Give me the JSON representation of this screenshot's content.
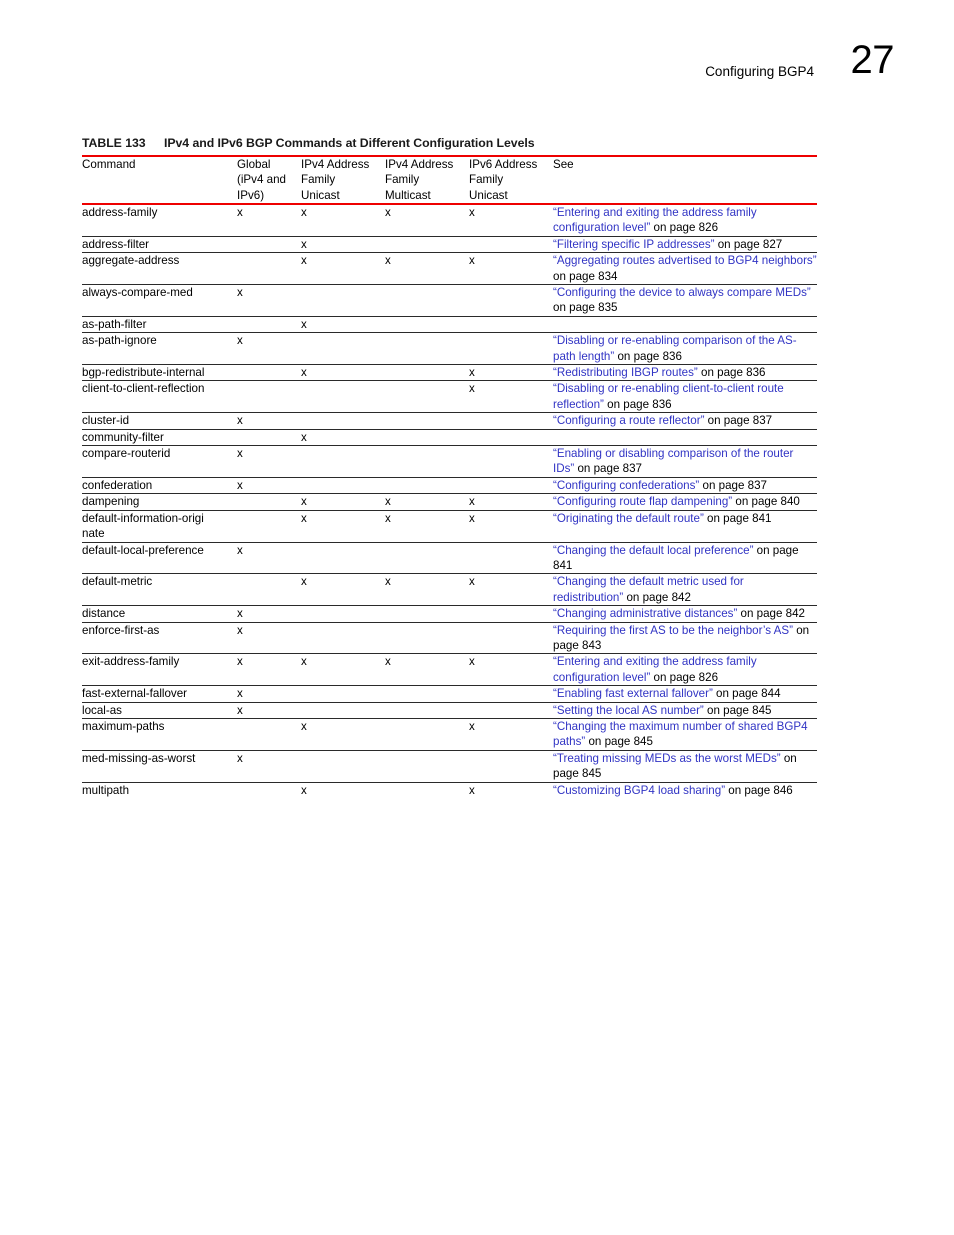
{
  "header": {
    "chapter_title": "Configuring BGP4",
    "page_number": "27"
  },
  "table": {
    "caption_label": "TABLE 133",
    "caption_title": "IPv4 and IPv6 BGP Commands at Different Configuration Levels",
    "columns": [
      {
        "id": "command",
        "lines": [
          "Command"
        ]
      },
      {
        "id": "global",
        "lines": [
          "Global",
          "(iPv4 and",
          "IPv6)"
        ]
      },
      {
        "id": "ipv4_unicast",
        "lines": [
          "IPv4 Address",
          "Family",
          "Unicast"
        ]
      },
      {
        "id": "ipv4_multicast",
        "lines": [
          "IPv4 Address",
          "Family",
          "Multicast"
        ]
      },
      {
        "id": "ipv6_unicast",
        "lines": [
          "IPv6 Address",
          "Family",
          "Unicast"
        ]
      },
      {
        "id": "see",
        "lines": [
          "See"
        ]
      }
    ],
    "mark": "x",
    "rows": [
      {
        "command": "address-family",
        "global": "x",
        "ipv4_unicast": "x",
        "ipv4_multicast": "x",
        "ipv6_unicast": "x",
        "see_title": "“Entering and exiting the address family configuration level”",
        "see_tail": " on page 826"
      },
      {
        "command": "address-filter",
        "global": "",
        "ipv4_unicast": "x",
        "ipv4_multicast": "",
        "ipv6_unicast": "",
        "see_title": "“Filtering specific IP addresses”",
        "see_tail": " on page 827"
      },
      {
        "command": "aggregate-address",
        "global": "",
        "ipv4_unicast": "x",
        "ipv4_multicast": "x",
        "ipv6_unicast": "x",
        "see_title": "“Aggregating routes advertised to BGP4 neighbors”",
        "see_tail": " on page 834"
      },
      {
        "command": "always-compare-med",
        "global": "x",
        "ipv4_unicast": "",
        "ipv4_multicast": "",
        "ipv6_unicast": "",
        "see_title": "“Configuring the device to always compare MEDs”",
        "see_tail": " on page 835"
      },
      {
        "command": "as-path-filter",
        "global": "",
        "ipv4_unicast": "x",
        "ipv4_multicast": "",
        "ipv6_unicast": "",
        "see_title": "",
        "see_tail": ""
      },
      {
        "command": "as-path-ignore",
        "global": "x",
        "ipv4_unicast": "",
        "ipv4_multicast": "",
        "ipv6_unicast": "",
        "see_title": "“Disabling or re-enabling comparison of the AS-path length”",
        "see_tail": " on page 836"
      },
      {
        "command": "bgp-redistribute-internal",
        "global": "",
        "ipv4_unicast": "x",
        "ipv4_multicast": "",
        "ipv6_unicast": "x",
        "see_title": "“Redistributing IBGP routes”",
        "see_tail": " on page 836"
      },
      {
        "command": "client-to-client-reflection",
        "global": "",
        "ipv4_unicast": "",
        "ipv4_multicast": "",
        "ipv6_unicast": "x",
        "see_title": "“Disabling or re-enabling client-to-client route reflection”",
        "see_tail": " on page 836"
      },
      {
        "command": "cluster-id",
        "global": "x",
        "ipv4_unicast": "",
        "ipv4_multicast": "",
        "ipv6_unicast": "",
        "see_title": "“Configuring a route reflector”",
        "see_tail": " on page 837"
      },
      {
        "command": "community-filter",
        "global": "",
        "ipv4_unicast": "x",
        "ipv4_multicast": "",
        "ipv6_unicast": "",
        "see_title": "",
        "see_tail": ""
      },
      {
        "command": "compare-routerid",
        "global": "x",
        "ipv4_unicast": "",
        "ipv4_multicast": "",
        "ipv6_unicast": "",
        "see_title": "“Enabling or disabling comparison of the router IDs”",
        "see_tail": " on page 837"
      },
      {
        "command": "confederation",
        "global": "x",
        "ipv4_unicast": "",
        "ipv4_multicast": "",
        "ipv6_unicast": "",
        "see_title": "“Configuring confederations”",
        "see_tail": " on page 837"
      },
      {
        "command": "dampening",
        "global": "",
        "ipv4_unicast": "x",
        "ipv4_multicast": "x",
        "ipv6_unicast": "x",
        "see_title": "“Configuring route flap dampening”",
        "see_tail": " on page 840"
      },
      {
        "command": "default-information-origi\nnate",
        "global": "",
        "ipv4_unicast": "x",
        "ipv4_multicast": "x",
        "ipv6_unicast": "x",
        "see_title": "“Originating the default route”",
        "see_tail": " on page 841"
      },
      {
        "command": "default-local-preference",
        "global": "x",
        "ipv4_unicast": "",
        "ipv4_multicast": "",
        "ipv6_unicast": "",
        "see_title": "“Changing the default local preference”",
        "see_tail": " on page 841"
      },
      {
        "command": "default-metric",
        "global": "",
        "ipv4_unicast": "x",
        "ipv4_multicast": "x",
        "ipv6_unicast": "x",
        "see_title": "“Changing the default metric used for redistribution”",
        "see_tail": " on page 842"
      },
      {
        "command": "distance",
        "global": "x",
        "ipv4_unicast": "",
        "ipv4_multicast": "",
        "ipv6_unicast": "",
        "see_title": "“Changing administrative distances”",
        "see_tail": " on page 842"
      },
      {
        "command": "enforce-first-as",
        "global": "x",
        "ipv4_unicast": "",
        "ipv4_multicast": "",
        "ipv6_unicast": "",
        "see_title": "“Requiring the first AS to be the neighbor’s AS”",
        "see_tail": " on page 843"
      },
      {
        "command": "exit-address-family",
        "global": "x",
        "ipv4_unicast": "x",
        "ipv4_multicast": "x",
        "ipv6_unicast": "x",
        "see_title": "“Entering and exiting the address family configuration level”",
        "see_tail": " on page 826"
      },
      {
        "command": "fast-external-fallover",
        "global": "x",
        "ipv4_unicast": "",
        "ipv4_multicast": "",
        "ipv6_unicast": "",
        "see_title": "“Enabling fast external fallover”",
        "see_tail": " on page 844"
      },
      {
        "command": "local-as",
        "global": "x",
        "ipv4_unicast": "",
        "ipv4_multicast": "",
        "ipv6_unicast": "",
        "see_title": "“Setting the local AS number”",
        "see_tail": " on page 845"
      },
      {
        "command": "maximum-paths",
        "global": "",
        "ipv4_unicast": "x",
        "ipv4_multicast": "",
        "ipv6_unicast": "x",
        "see_title": "“Changing the maximum number of shared BGP4 paths”",
        "see_tail": " on page 845"
      },
      {
        "command": "med-missing-as-worst",
        "global": "x",
        "ipv4_unicast": "",
        "ipv4_multicast": "",
        "ipv6_unicast": "",
        "see_title": "“Treating missing MEDs as the worst MEDs”",
        "see_tail": " on page 845"
      },
      {
        "command": "multipath",
        "global": "",
        "ipv4_unicast": "x",
        "ipv4_multicast": "",
        "ipv6_unicast": "x",
        "see_title": "“Customizing BGP4 load sharing”",
        "see_tail": " on page 846"
      }
    ]
  },
  "colors": {
    "rule_red": "#ee0000",
    "link_blue": "#3134c4",
    "text_black": "#000000"
  }
}
